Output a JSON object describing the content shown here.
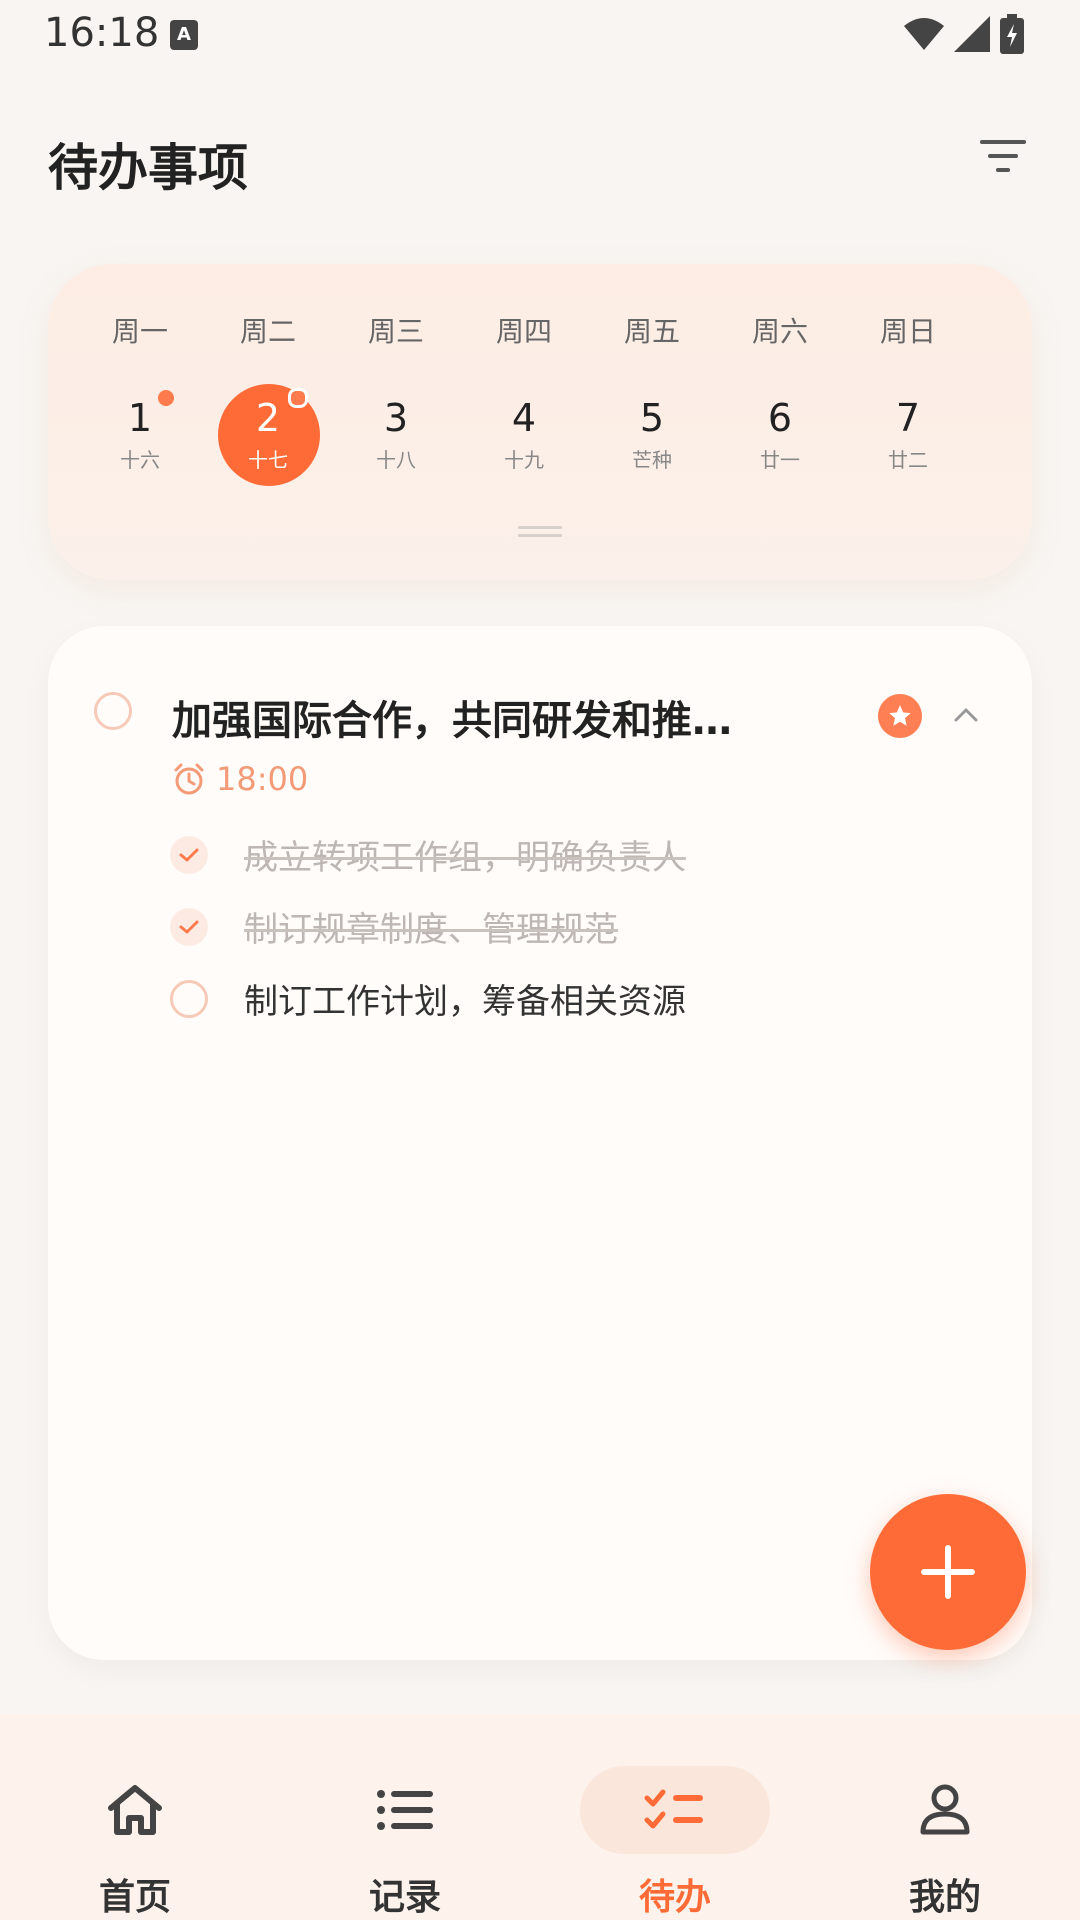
{
  "status_bar": {
    "time": "16:18",
    "input_indicator": "A"
  },
  "header": {
    "title": "待办事项"
  },
  "calendar": {
    "weekdays": [
      "周一",
      "周二",
      "周三",
      "周四",
      "周五",
      "周六",
      "周日"
    ],
    "days": [
      {
        "num": "1",
        "lunar": "十六"
      },
      {
        "num": "2",
        "lunar": "十七"
      },
      {
        "num": "3",
        "lunar": "十八"
      },
      {
        "num": "4",
        "lunar": "十九"
      },
      {
        "num": "5",
        "lunar": "芒种"
      },
      {
        "num": "6",
        "lunar": "廿一"
      },
      {
        "num": "7",
        "lunar": "廿二"
      }
    ]
  },
  "task": {
    "title": "加强国际合作，共同研发和推广先进技术",
    "time": "18:00",
    "subtasks": [
      {
        "text": "成立转项工作组，明确负责人",
        "done": true
      },
      {
        "text": "制订规章制度、管理规范",
        "done": true
      },
      {
        "text": "制订工作计划，筹备相关资源",
        "done": false
      }
    ]
  },
  "nav": {
    "items": [
      {
        "label": "首页",
        "icon": "home-icon"
      },
      {
        "label": "记录",
        "icon": "list-icon"
      },
      {
        "label": "待办",
        "icon": "todo-icon"
      },
      {
        "label": "我的",
        "icon": "profile-icon"
      }
    ]
  },
  "colors": {
    "accent": "#FF6B36",
    "background": "#F8F5F2"
  }
}
